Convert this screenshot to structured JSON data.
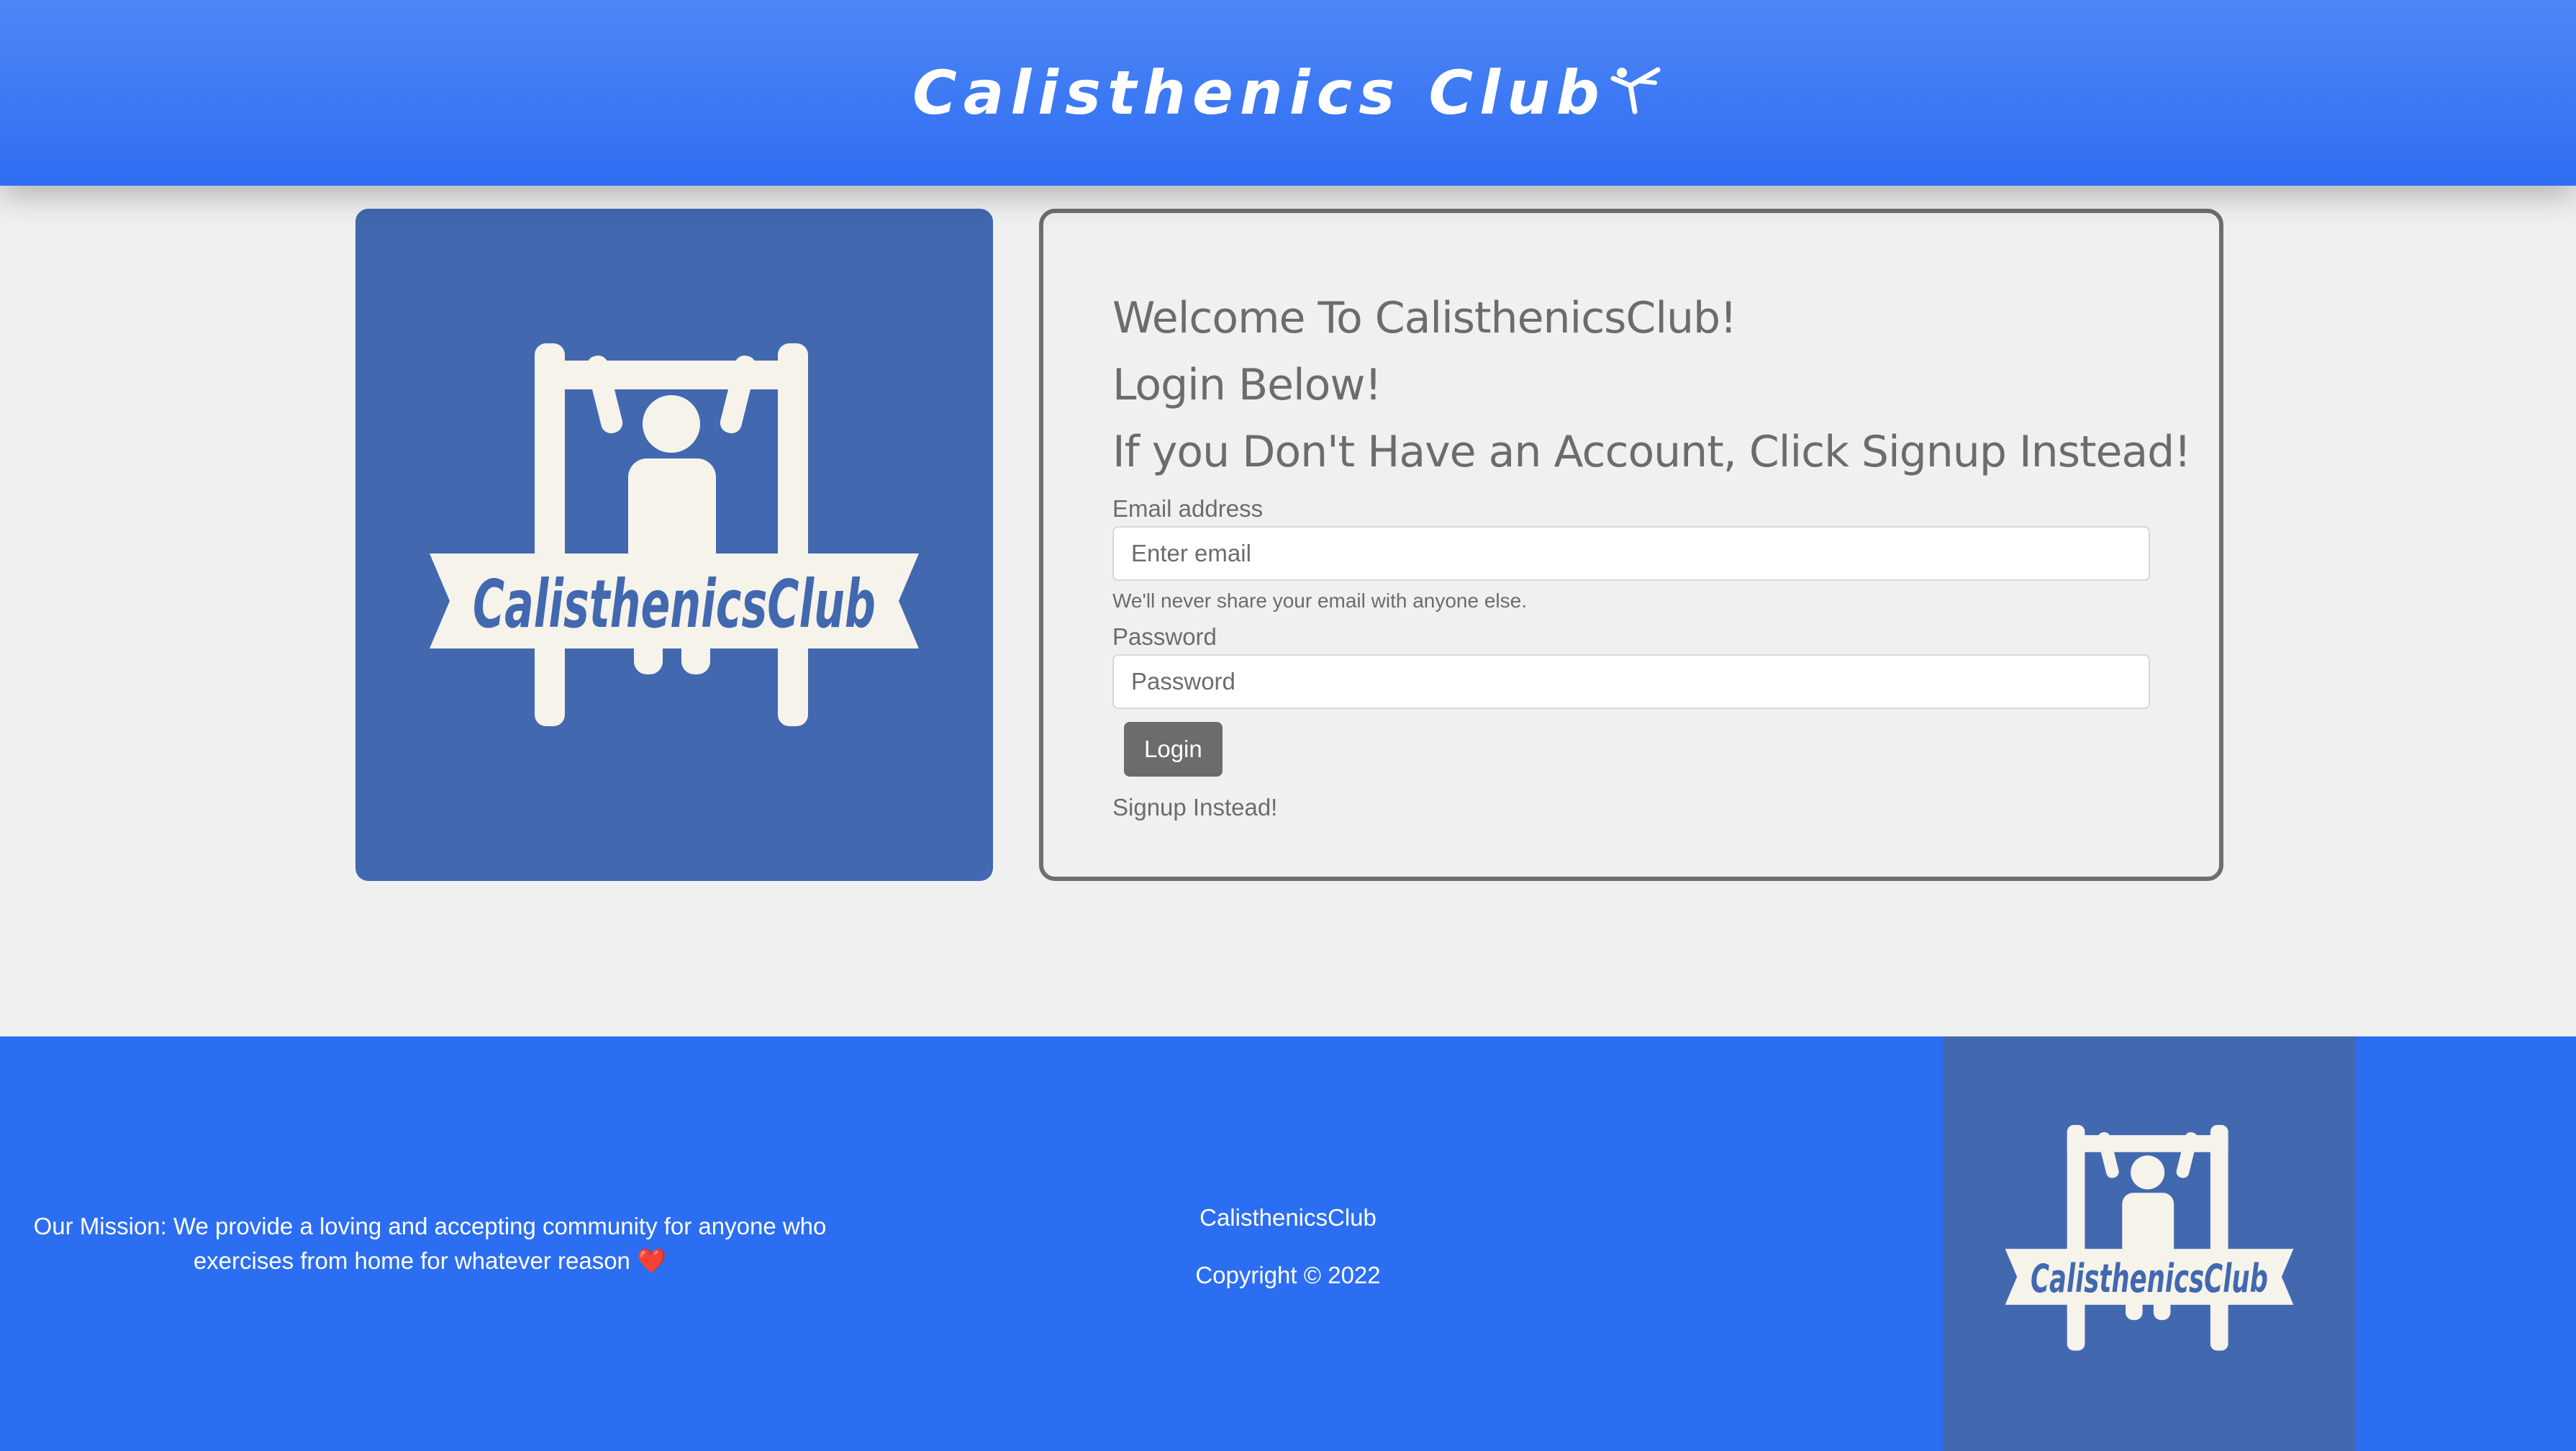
{
  "header": {
    "title": "Calisthenics Club",
    "icon": "gymnast-icon"
  },
  "logo": {
    "text": "CalisthenicsClub",
    "icon": "pullup-logo-icon"
  },
  "login": {
    "welcome": "Welcome To CalisthenicsClub!",
    "login_below": "Login Below!",
    "signup_prompt": "If you Don't Have an Account, Click Signup Instead!",
    "email_label": "Email address",
    "email_placeholder": "Enter email",
    "email_help": "We'll never share your email with anyone else.",
    "password_label": "Password",
    "password_placeholder": "Password",
    "login_button": "Login",
    "signup_link": "Signup Instead!"
  },
  "footer": {
    "mission_text": "Our Mission: We provide a loving and accepting community for anyone who exercises from home for whatever reason",
    "heart": "❤️",
    "brand": "CalisthenicsClub",
    "copyright": "Copyright © 2022"
  },
  "colors": {
    "header_bg": "#3978f4",
    "footer_bg": "#2c6ef2",
    "logo_bg": "#4268b0",
    "logo_fg": "#f5f3ea",
    "text_gray": "#6c6c6c",
    "page_bg": "#f0f0f0"
  }
}
